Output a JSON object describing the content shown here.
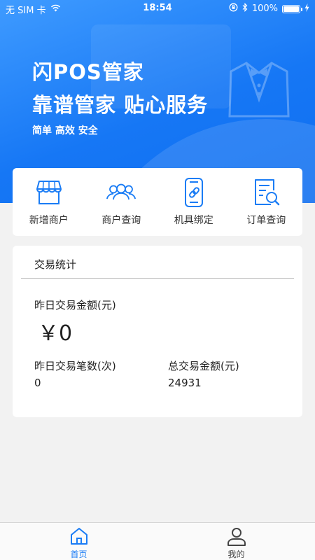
{
  "status_bar": {
    "carrier": "无 SIM 卡",
    "time": "18:54",
    "battery": "100%"
  },
  "hero": {
    "title": "闪POS管家",
    "slogan": "靠谱管家 贴心服务",
    "tags": "简单 高效 安全"
  },
  "quick_actions": [
    {
      "label": "新增商户",
      "icon": "storefront-icon"
    },
    {
      "label": "商户查询",
      "icon": "users-icon"
    },
    {
      "label": "机具绑定",
      "icon": "device-link-icon"
    },
    {
      "label": "订单查询",
      "icon": "document-search-icon"
    }
  ],
  "stats": {
    "title": "交易统计",
    "yesterday_amount_label": "昨日交易金额(元)",
    "yesterday_amount": "￥0",
    "yesterday_count_label": "昨日交易笔数(次)",
    "yesterday_count": "0",
    "total_amount_label": "总交易金额(元)",
    "total_amount": "24931"
  },
  "tabbar": {
    "home_label": "首页",
    "mine_label": "我的"
  },
  "colors": {
    "accent": "#1a7cf5",
    "hero_start": "#3f9bff",
    "hero_end": "#0f6ef0"
  }
}
